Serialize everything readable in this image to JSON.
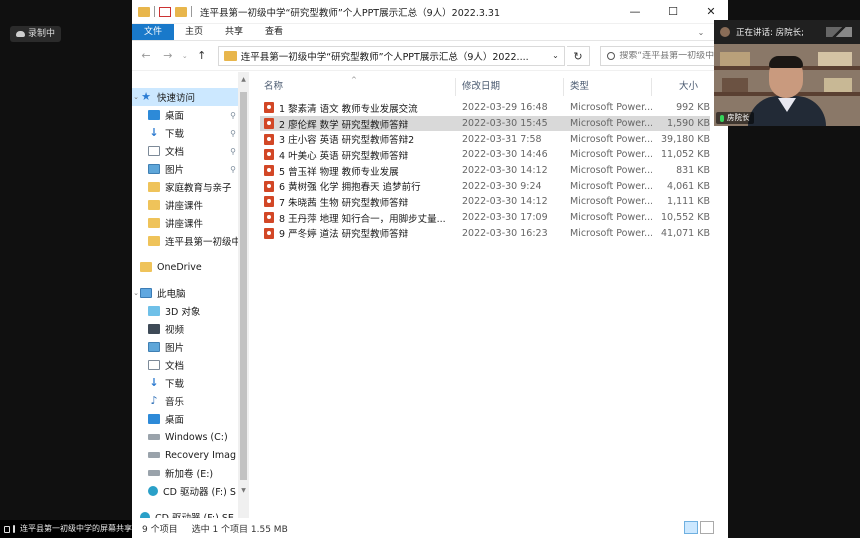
{
  "meeting": {
    "recording_label": "录制中",
    "share_label": "连平县第一初级中学的屏幕共享",
    "speaking_label": "正在讲话: 房院长;",
    "speaker_name": "房院长"
  },
  "window": {
    "title": "连平县第一初级中学“研究型教师”个人PPT展示汇总（9人）2022.3.31",
    "controls": {
      "minimize": "—",
      "maximize": "☐",
      "close": "✕"
    }
  },
  "ribbon": {
    "file": "文件",
    "home": "主页",
    "share": "共享",
    "view": "查看"
  },
  "address": {
    "path": "连平县第一初级中学“研究型教师”个人PPT展示汇总（9人）2022....",
    "search_placeholder": "搜索“连平县第一初级中..."
  },
  "nav": {
    "quick_access": "快速访问",
    "quick_items": [
      {
        "label": "桌面",
        "icon": "desktop-icon"
      },
      {
        "label": "下载",
        "icon": "download-icon"
      },
      {
        "label": "文档",
        "icon": "document-icon"
      },
      {
        "label": "图片",
        "icon": "picture-icon"
      },
      {
        "label": "家庭教育与亲子",
        "icon": "folder-icon"
      },
      {
        "label": "讲座课件",
        "icon": "folder-icon"
      },
      {
        "label": "讲座课件",
        "icon": "folder-icon"
      },
      {
        "label": "连平县第一初级中",
        "icon": "folder-icon"
      }
    ],
    "onedrive": "OneDrive",
    "this_pc": "此电脑",
    "pc_items": [
      {
        "label": "3D 对象",
        "icon": "3d-objects-icon"
      },
      {
        "label": "视频",
        "icon": "video-icon"
      },
      {
        "label": "图片",
        "icon": "picture-icon"
      },
      {
        "label": "文档",
        "icon": "document-icon"
      },
      {
        "label": "下载",
        "icon": "download-icon"
      },
      {
        "label": "音乐",
        "icon": "music-icon"
      },
      {
        "label": "桌面",
        "icon": "desktop-icon"
      },
      {
        "label": "Windows  (C:)",
        "icon": "drive-icon"
      },
      {
        "label": "Recovery Imag",
        "icon": "drive-icon"
      },
      {
        "label": "新加卷 (E:)",
        "icon": "drive-icon"
      },
      {
        "label": "CD 驱动器 (F:) S",
        "icon": "cd-drive-icon"
      }
    ],
    "bottom_item": "CD 驱动器 (F:) SE"
  },
  "columns": {
    "name": "名称",
    "date": "修改日期",
    "type": "类型",
    "size": "大小"
  },
  "files": [
    {
      "name": "1 黎素清  语文  教师专业发展交流",
      "date": "2022-03-29 16:48",
      "type": "Microsoft Power...",
      "size": "992 KB"
    },
    {
      "name": "2 廖伦辉  数学  研究型教师答辩",
      "date": "2022-03-30 15:45",
      "type": "Microsoft Power...",
      "size": "1,590 KB",
      "selected": true
    },
    {
      "name": "3 庄小容  英语  研究型教师答辩2",
      "date": "2022-03-31 7:58",
      "type": "Microsoft Power...",
      "size": "39,180 KB"
    },
    {
      "name": "4 叶美心  英语  研究型教师答辩",
      "date": "2022-03-30 14:46",
      "type": "Microsoft Power...",
      "size": "11,052 KB"
    },
    {
      "name": "5 曾玉祥  物理  教师专业发展",
      "date": "2022-03-30 14:12",
      "type": "Microsoft Power...",
      "size": "831 KB"
    },
    {
      "name": "6 黄树强  化学  拥抱春天 追梦前行",
      "date": "2022-03-30 9:24",
      "type": "Microsoft Power...",
      "size": "4,061 KB"
    },
    {
      "name": "7 朱晓茜  生物  研究型教师答辩",
      "date": "2022-03-30 14:12",
      "type": "Microsoft Power...",
      "size": "1,111 KB"
    },
    {
      "name": "8 王丹萍  地理  知行合一，用脚步丈量...",
      "date": "2022-03-30 17:09",
      "type": "Microsoft Power...",
      "size": "10,552 KB"
    },
    {
      "name": "9  严冬婷  道法  研究型教师答辩",
      "date": "2022-03-30 16:23",
      "type": "Microsoft Power...",
      "size": "41,071 KB"
    }
  ],
  "status": {
    "count": "9 个项目",
    "selected": "选中 1 个项目  1.55 MB"
  },
  "colors": {
    "accent": "#1979ca",
    "selection": "#cce8ff",
    "ppt": "#d24726"
  }
}
